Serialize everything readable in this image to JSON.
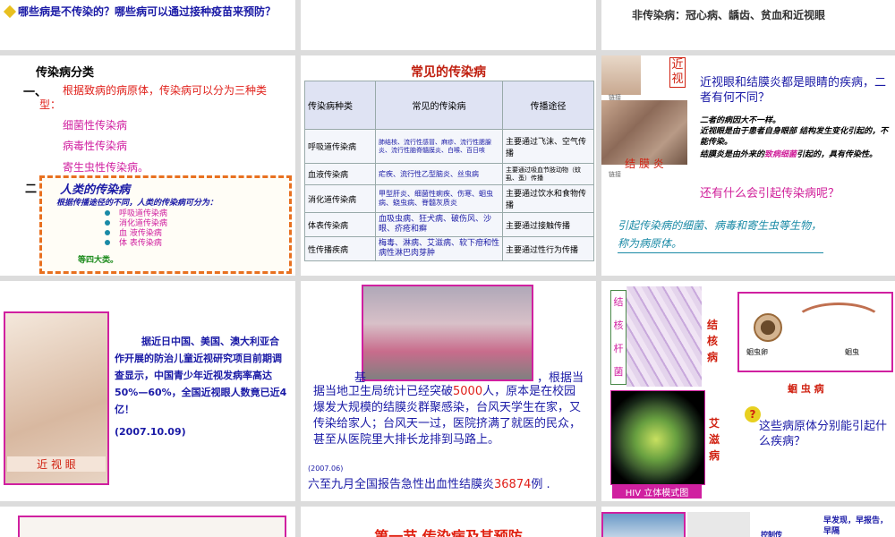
{
  "s1": {
    "question": "哪些病是不传染的？哪些病可以通过接种疫苗来预防？"
  },
  "s3": {
    "text": "非传染病：冠心病、龋齿、贫血和近视眼"
  },
  "s4": {
    "title": "传染病分类",
    "item1_num": "一、",
    "item1": "根据致病的病原体，传染病可以分为三种类型：",
    "types": [
      "细菌性传染病",
      "病毒性传染病",
      "寄生虫性传染病。"
    ],
    "item2_num": "二",
    "box_title": "人类的传染病",
    "box_desc": "根据传播途径的不同，人类的传染病可分为：",
    "box_items": [
      "呼吸道传染病",
      "消化道传染病",
      "血 液传染病",
      "体 表传染病"
    ],
    "box_footer": "等四大类。"
  },
  "s5": {
    "title": "常见的传染病",
    "headers": [
      "传染病种类",
      "常见的传染病",
      "传播途径"
    ],
    "rows": [
      {
        "type": "呼吸道传染病",
        "diseases": "肺结核、流行性感冒、麻疹、流行性腮腺炎、流行性脑脊髓膜炎、白喉、百日咳",
        "route": "主要通过飞沫、空气传播"
      },
      {
        "type": "血液传染病",
        "diseases": "疟疾、流行性乙型脑炎、丝虫病",
        "route": "主要通过吸血节肢动物（蚊虱、蚤）传播"
      },
      {
        "type": "消化道传染病",
        "diseases": "甲型肝炎、细菌性痢疾、伤寒、蛔虫病、蛲虫病、脊髓灰质炎",
        "route": "主要通过饮水和食物传播"
      },
      {
        "type": "体表传染病",
        "diseases": "血吸虫病、狂犬病、破伤风、沙眼、疥疮和癣",
        "route": "主要通过接触传播"
      },
      {
        "type": "性传播疾病",
        "diseases": "梅毒、淋病、艾滋病、软下疳和性病性淋巴肉芽肿",
        "route": "主要通过性行为传播"
      }
    ]
  },
  "s6": {
    "label_top": "近视",
    "label_bottom": "结 膜 炎",
    "link1": "链接",
    "link2": "链接",
    "question": "近视眼和结膜炎都是眼睛的疾病，二者有何不同？",
    "answer_head": "二者的病因大不一样。",
    "answer_1": "近视眼是由于患者自身眼部 结构发生变化引起的，不能传染。",
    "answer_2a": "结膜炎是由外来的",
    "answer_2b": "致病细菌",
    "answer_2c": "引起的，具有传染性。",
    "question2": "还有什么会引起传染病呢？",
    "definition": "引起传染病的细菌、病毒和寄生虫等生物，称为病原体。"
  },
  "s7": {
    "text": "据近日中国、美国、澳大利亚合作开展的防治儿童近视研究项目前期调查显示，中国青少年近视发病率高达50%—60%，全国近视眼人数竟已近4亿！",
    "date": "(2007.10.09)",
    "caption": "近 视 眼"
  },
  "s8": {
    "para_a": "据当地卫生局统计已经突破",
    "number1": "5000",
    "para_b": "人，原本是在校园爆发大规模的结膜炎群聚感染，台风天学生在家，又传染给家人；台风天一过，医院挤满了就医的民众，甚至从医院里大排长龙排到马路上。",
    "lead": "基",
    "lead_tail": "，根据当",
    "date": "(2007.06)",
    "stat_a": "六至九月全国报告急性出血性结膜炎",
    "number2": "36874",
    "stat_b": "例 ."
  },
  "s9": {
    "tb_label": "结核杆菌",
    "tb_disease": "结核病",
    "aids": "艾滋病",
    "hiv_caption": "HIV 立体模式图",
    "egg_label": "蛔虫卵",
    "worm_label": "蛔虫",
    "worm_disease": "蛔 虫 病",
    "question": "这些病原体分别能引起什么疾病？",
    "badge": "?"
  },
  "s11": {
    "title": "第一节 传染病及其预防"
  },
  "s12": {
    "label": "控制传",
    "text": "早发现，早报告，早隔"
  }
}
